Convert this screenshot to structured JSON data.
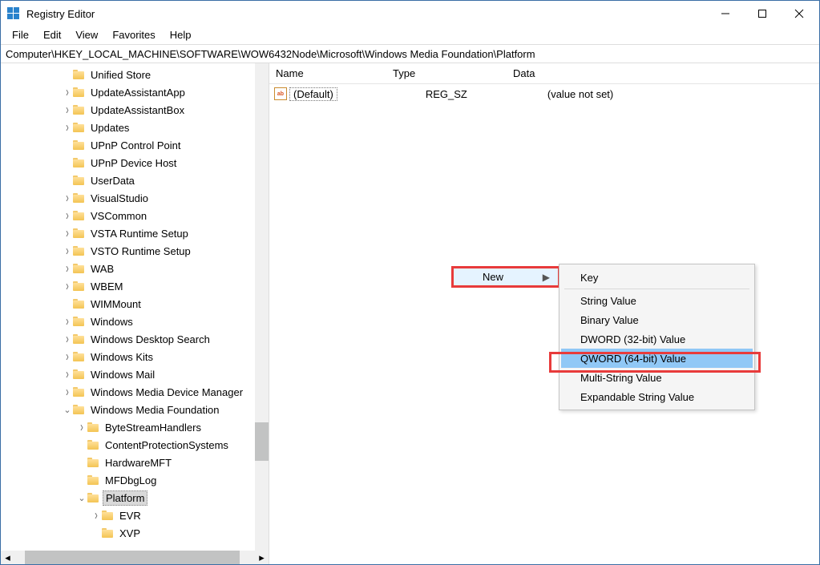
{
  "title": "Registry Editor",
  "menu": [
    "File",
    "Edit",
    "View",
    "Favorites",
    "Help"
  ],
  "address": "Computer\\HKEY_LOCAL_MACHINE\\SOFTWARE\\WOW6432Node\\Microsoft\\Windows Media Foundation\\Platform",
  "tree": [
    {
      "d": 3,
      "e": "",
      "n": "Unified Store"
    },
    {
      "d": 3,
      "e": ">",
      "n": "UpdateAssistantApp"
    },
    {
      "d": 3,
      "e": ">",
      "n": "UpdateAssistantBox"
    },
    {
      "d": 3,
      "e": ">",
      "n": "Updates"
    },
    {
      "d": 3,
      "e": "",
      "n": "UPnP Control Point"
    },
    {
      "d": 3,
      "e": "",
      "n": "UPnP Device Host"
    },
    {
      "d": 3,
      "e": "",
      "n": "UserData"
    },
    {
      "d": 3,
      "e": ">",
      "n": "VisualStudio"
    },
    {
      "d": 3,
      "e": ">",
      "n": "VSCommon"
    },
    {
      "d": 3,
      "e": ">",
      "n": "VSTA Runtime Setup"
    },
    {
      "d": 3,
      "e": ">",
      "n": "VSTO Runtime Setup"
    },
    {
      "d": 3,
      "e": ">",
      "n": "WAB"
    },
    {
      "d": 3,
      "e": ">",
      "n": "WBEM"
    },
    {
      "d": 3,
      "e": "",
      "n": "WIMMount"
    },
    {
      "d": 3,
      "e": ">",
      "n": "Windows"
    },
    {
      "d": 3,
      "e": ">",
      "n": "Windows Desktop Search"
    },
    {
      "d": 3,
      "e": ">",
      "n": "Windows Kits"
    },
    {
      "d": 3,
      "e": ">",
      "n": "Windows Mail"
    },
    {
      "d": 3,
      "e": ">",
      "n": "Windows Media Device Manager"
    },
    {
      "d": 3,
      "e": "v",
      "n": "Windows Media Foundation"
    },
    {
      "d": 4,
      "e": ">",
      "n": "ByteStreamHandlers"
    },
    {
      "d": 4,
      "e": "",
      "n": "ContentProtectionSystems"
    },
    {
      "d": 4,
      "e": "",
      "n": "HardwareMFT"
    },
    {
      "d": 4,
      "e": "",
      "n": "MFDbgLog"
    },
    {
      "d": 4,
      "e": "v",
      "n": "Platform",
      "sel": true
    },
    {
      "d": 5,
      "e": ">",
      "n": "EVR"
    },
    {
      "d": 5,
      "e": "",
      "n": "XVP"
    }
  ],
  "columns": {
    "name": "Name",
    "type": "Type",
    "data": "Data"
  },
  "value_row": {
    "name": "(Default)",
    "type": "REG_SZ",
    "data": "(value not set)"
  },
  "ctx1_label": "New",
  "submenu": [
    "Key",
    "String Value",
    "Binary Value",
    "DWORD (32-bit) Value",
    "QWORD (64-bit) Value",
    "Multi-String Value",
    "Expandable String Value"
  ]
}
